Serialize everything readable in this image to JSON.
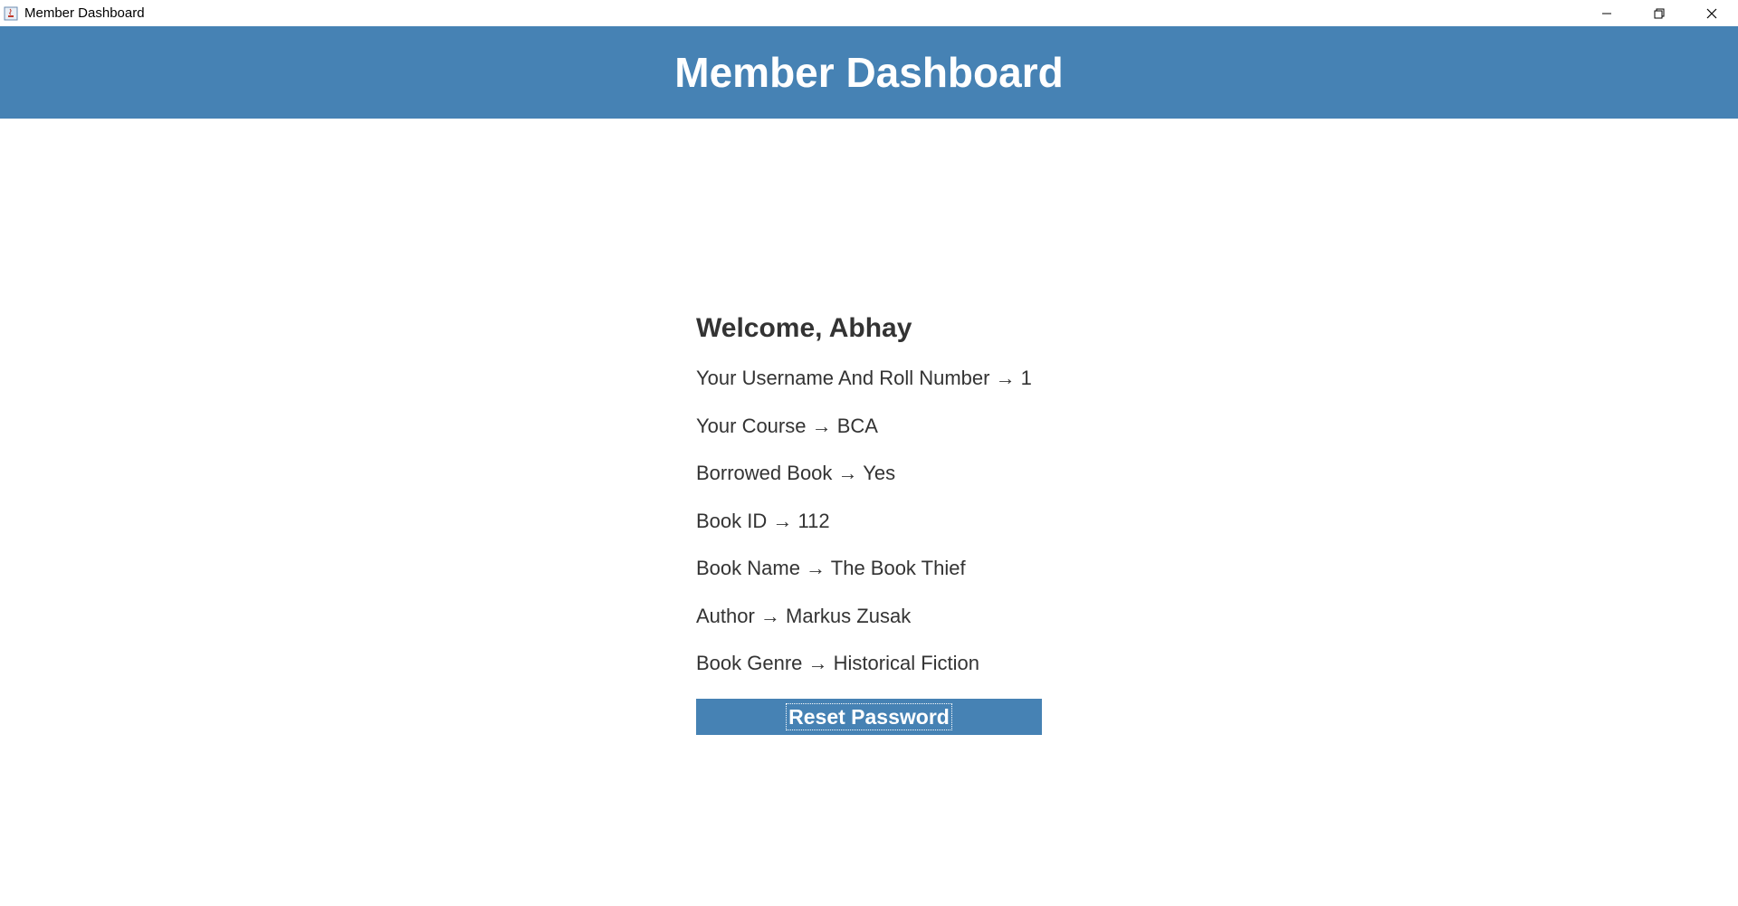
{
  "window": {
    "title": "Member Dashboard",
    "controls": [
      "minimize-icon",
      "restore-icon",
      "close-icon"
    ]
  },
  "header": {
    "title": "Member Dashboard"
  },
  "main": {
    "welcome": "Welcome, Abhay",
    "info": [
      "Your Username And Roll Number → 1",
      "Your Course → BCA",
      "Borrowed Book → Yes",
      "Book ID → 112",
      "Book Name → The Book Thief",
      "Author → Markus Zusak",
      "Book Genre → Historical Fiction"
    ],
    "reset_button": "Reset Password"
  },
  "colors": {
    "accent": "#4682b4",
    "text": "#333333",
    "background": "#ffffff"
  }
}
